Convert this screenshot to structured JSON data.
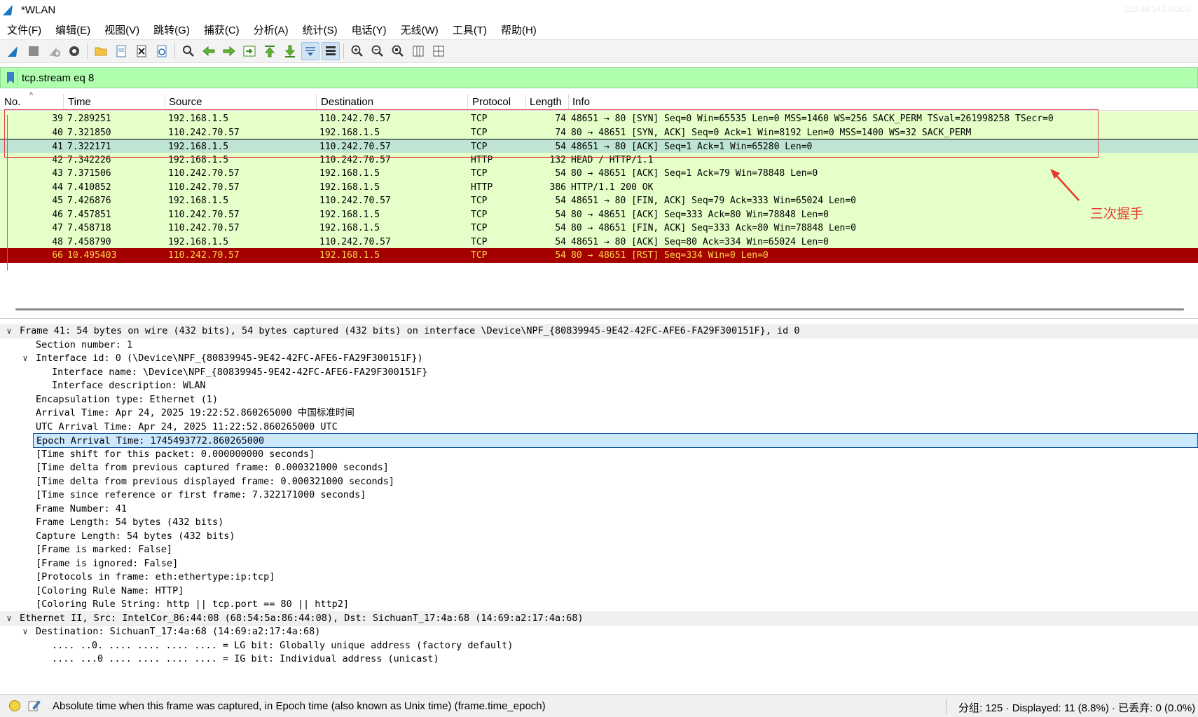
{
  "window": {
    "title": "*WLAN",
    "ghost_text": "128.88.141   SOLU"
  },
  "menu": [
    {
      "label": "文件(F)"
    },
    {
      "label": "编辑(E)"
    },
    {
      "label": "视图(V)"
    },
    {
      "label": "跳转(G)"
    },
    {
      "label": "捕获(C)"
    },
    {
      "label": "分析(A)"
    },
    {
      "label": "统计(S)"
    },
    {
      "label": "电话(Y)"
    },
    {
      "label": "无线(W)"
    },
    {
      "label": "工具(T)"
    },
    {
      "label": "帮助(H)"
    }
  ],
  "toolbar": {
    "icons": [
      "shark-fin-start-icon",
      "stop-square-icon",
      "restart-shark-icon",
      "capture-options-gear-icon",
      "open-folder-icon",
      "save-file-icon",
      "close-file-icon",
      "reload-file-icon",
      "find-packet-magnifier-icon",
      "go-back-arrow-icon",
      "go-forward-arrow-icon",
      "go-to-packet-icon",
      "go-first-packet-icon",
      "go-last-packet-icon",
      "autoscroll-icon",
      "colorize-icon",
      "zoom-in-icon",
      "zoom-out-icon",
      "zoom-normal-icon",
      "resize-columns-icon",
      "expand-subtrees-icon"
    ]
  },
  "filter": {
    "text": "tcp.stream eq 8"
  },
  "columns": {
    "no": "No.",
    "time": "Time",
    "source": "Source",
    "destination": "Destination",
    "protocol": "Protocol",
    "length": "Length",
    "info": "Info"
  },
  "packets": [
    {
      "no": "39",
      "time": "7.289251",
      "src": "192.168.1.5",
      "dst": "110.242.70.57",
      "proto": "TCP",
      "len": "74",
      "info": "48651 → 80 [SYN] Seq=0 Win=65535 Len=0 MSS=1460 WS=256 SACK_PERM TSval=261998258 TSecr=0"
    },
    {
      "no": "40",
      "time": "7.321850",
      "src": "110.242.70.57",
      "dst": "192.168.1.5",
      "proto": "TCP",
      "len": "74",
      "info": "80 → 48651 [SYN, ACK] Seq=0 Ack=1 Win=8192 Len=0 MSS=1400 WS=32 SACK_PERM"
    },
    {
      "no": "41",
      "time": "7.322171",
      "src": "192.168.1.5",
      "dst": "110.242.70.57",
      "proto": "TCP",
      "len": "54",
      "info": "48651 → 80 [ACK] Seq=1 Ack=1 Win=65280 Len=0"
    },
    {
      "no": "42",
      "time": "7.342226",
      "src": "192.168.1.5",
      "dst": "110.242.70.57",
      "proto": "HTTP",
      "len": "132",
      "info": "HEAD / HTTP/1.1"
    },
    {
      "no": "43",
      "time": "7.371506",
      "src": "110.242.70.57",
      "dst": "192.168.1.5",
      "proto": "TCP",
      "len": "54",
      "info": "80 → 48651 [ACK] Seq=1 Ack=79 Win=78848 Len=0"
    },
    {
      "no": "44",
      "time": "7.410852",
      "src": "110.242.70.57",
      "dst": "192.168.1.5",
      "proto": "HTTP",
      "len": "386",
      "info": "HTTP/1.1 200 OK"
    },
    {
      "no": "45",
      "time": "7.426876",
      "src": "192.168.1.5",
      "dst": "110.242.70.57",
      "proto": "TCP",
      "len": "54",
      "info": "48651 → 80 [FIN, ACK] Seq=79 Ack=333 Win=65024 Len=0"
    },
    {
      "no": "46",
      "time": "7.457851",
      "src": "110.242.70.57",
      "dst": "192.168.1.5",
      "proto": "TCP",
      "len": "54",
      "info": "80 → 48651 [ACK] Seq=333 Ack=80 Win=78848 Len=0"
    },
    {
      "no": "47",
      "time": "7.458718",
      "src": "110.242.70.57",
      "dst": "192.168.1.5",
      "proto": "TCP",
      "len": "54",
      "info": "80 → 48651 [FIN, ACK] Seq=333 Ack=80 Win=78848 Len=0"
    },
    {
      "no": "48",
      "time": "7.458790",
      "src": "192.168.1.5",
      "dst": "110.242.70.57",
      "proto": "TCP",
      "len": "54",
      "info": "48651 → 80 [ACK] Seq=80 Ack=334 Win=65024 Len=0"
    },
    {
      "no": "66",
      "time": "10.495403",
      "src": "110.242.70.57",
      "dst": "192.168.1.5",
      "proto": "TCP",
      "len": "54",
      "info": "80 → 48651 [RST] Seq=334 Win=0 Len=0"
    }
  ],
  "annotation": {
    "label": "三次握手",
    "color": "#e8372c"
  },
  "details": [
    {
      "level": 0,
      "toggle": "expanded",
      "text": "Frame 41: 54 bytes on wire (432 bits), 54 bytes captured (432 bits) on interface \\Device\\NPF_{80839945-9E42-42FC-AFE6-FA29F300151F}, id 0",
      "header": true
    },
    {
      "level": 1,
      "text": "Section number: 1"
    },
    {
      "level": 1,
      "toggle": "expanded",
      "text": "Interface id: 0 (\\Device\\NPF_{80839945-9E42-42FC-AFE6-FA29F300151F})"
    },
    {
      "level": 2,
      "text": "Interface name: \\Device\\NPF_{80839945-9E42-42FC-AFE6-FA29F300151F}"
    },
    {
      "level": 2,
      "text": "Interface description: WLAN"
    },
    {
      "level": 1,
      "text": "Encapsulation type: Ethernet (1)"
    },
    {
      "level": 1,
      "text": "Arrival Time: Apr 24, 2025 19:22:52.860265000 中国标准时间"
    },
    {
      "level": 1,
      "text": "UTC Arrival Time: Apr 24, 2025 11:22:52.860265000 UTC"
    },
    {
      "level": 1,
      "text": "Epoch Arrival Time: 1745493772.860265000",
      "selected": true
    },
    {
      "level": 1,
      "text": "[Time shift for this packet: 0.000000000 seconds]"
    },
    {
      "level": 1,
      "text": "[Time delta from previous captured frame: 0.000321000 seconds]"
    },
    {
      "level": 1,
      "text": "[Time delta from previous displayed frame: 0.000321000 seconds]"
    },
    {
      "level": 1,
      "text": "[Time since reference or first frame: 7.322171000 seconds]"
    },
    {
      "level": 1,
      "text": "Frame Number: 41"
    },
    {
      "level": 1,
      "text": "Frame Length: 54 bytes (432 bits)"
    },
    {
      "level": 1,
      "text": "Capture Length: 54 bytes (432 bits)"
    },
    {
      "level": 1,
      "text": "[Frame is marked: False]"
    },
    {
      "level": 1,
      "text": "[Frame is ignored: False]"
    },
    {
      "level": 1,
      "text": "[Protocols in frame: eth:ethertype:ip:tcp]"
    },
    {
      "level": 1,
      "text": "[Coloring Rule Name: HTTP]"
    },
    {
      "level": 1,
      "text": "[Coloring Rule String: http || tcp.port == 80 || http2]"
    },
    {
      "level": 0,
      "toggle": "expanded",
      "text": "Ethernet II, Src: IntelCor_86:44:08 (68:54:5a:86:44:08), Dst: SichuanT_17:4a:68 (14:69:a2:17:4a:68)",
      "header": true
    },
    {
      "level": 1,
      "toggle": "expanded",
      "text": "Destination: SichuanT_17:4a:68 (14:69:a2:17:4a:68)"
    },
    {
      "level": 2,
      "text": ".... ..0. .... .... .... .... = LG bit: Globally unique address (factory default)"
    },
    {
      "level": 2,
      "text": ".... ...0 .... .... .... .... = IG bit: Individual address (unicast)"
    }
  ],
  "status": {
    "message": "Absolute time when this frame was captured, in Epoch time (also known as Unix time) (frame.time_epoch)",
    "stats": "分组: 125 · Displayed: 11 (8.8%) · 已丢弃: 0 (0.0%)"
  },
  "colors": {
    "tcp_row": "#e4ffc7",
    "selected_row": "#bfe4d4",
    "rst_row": "#a40000",
    "rst_text": "#ffd74a",
    "filter_bg": "#afffaf"
  }
}
